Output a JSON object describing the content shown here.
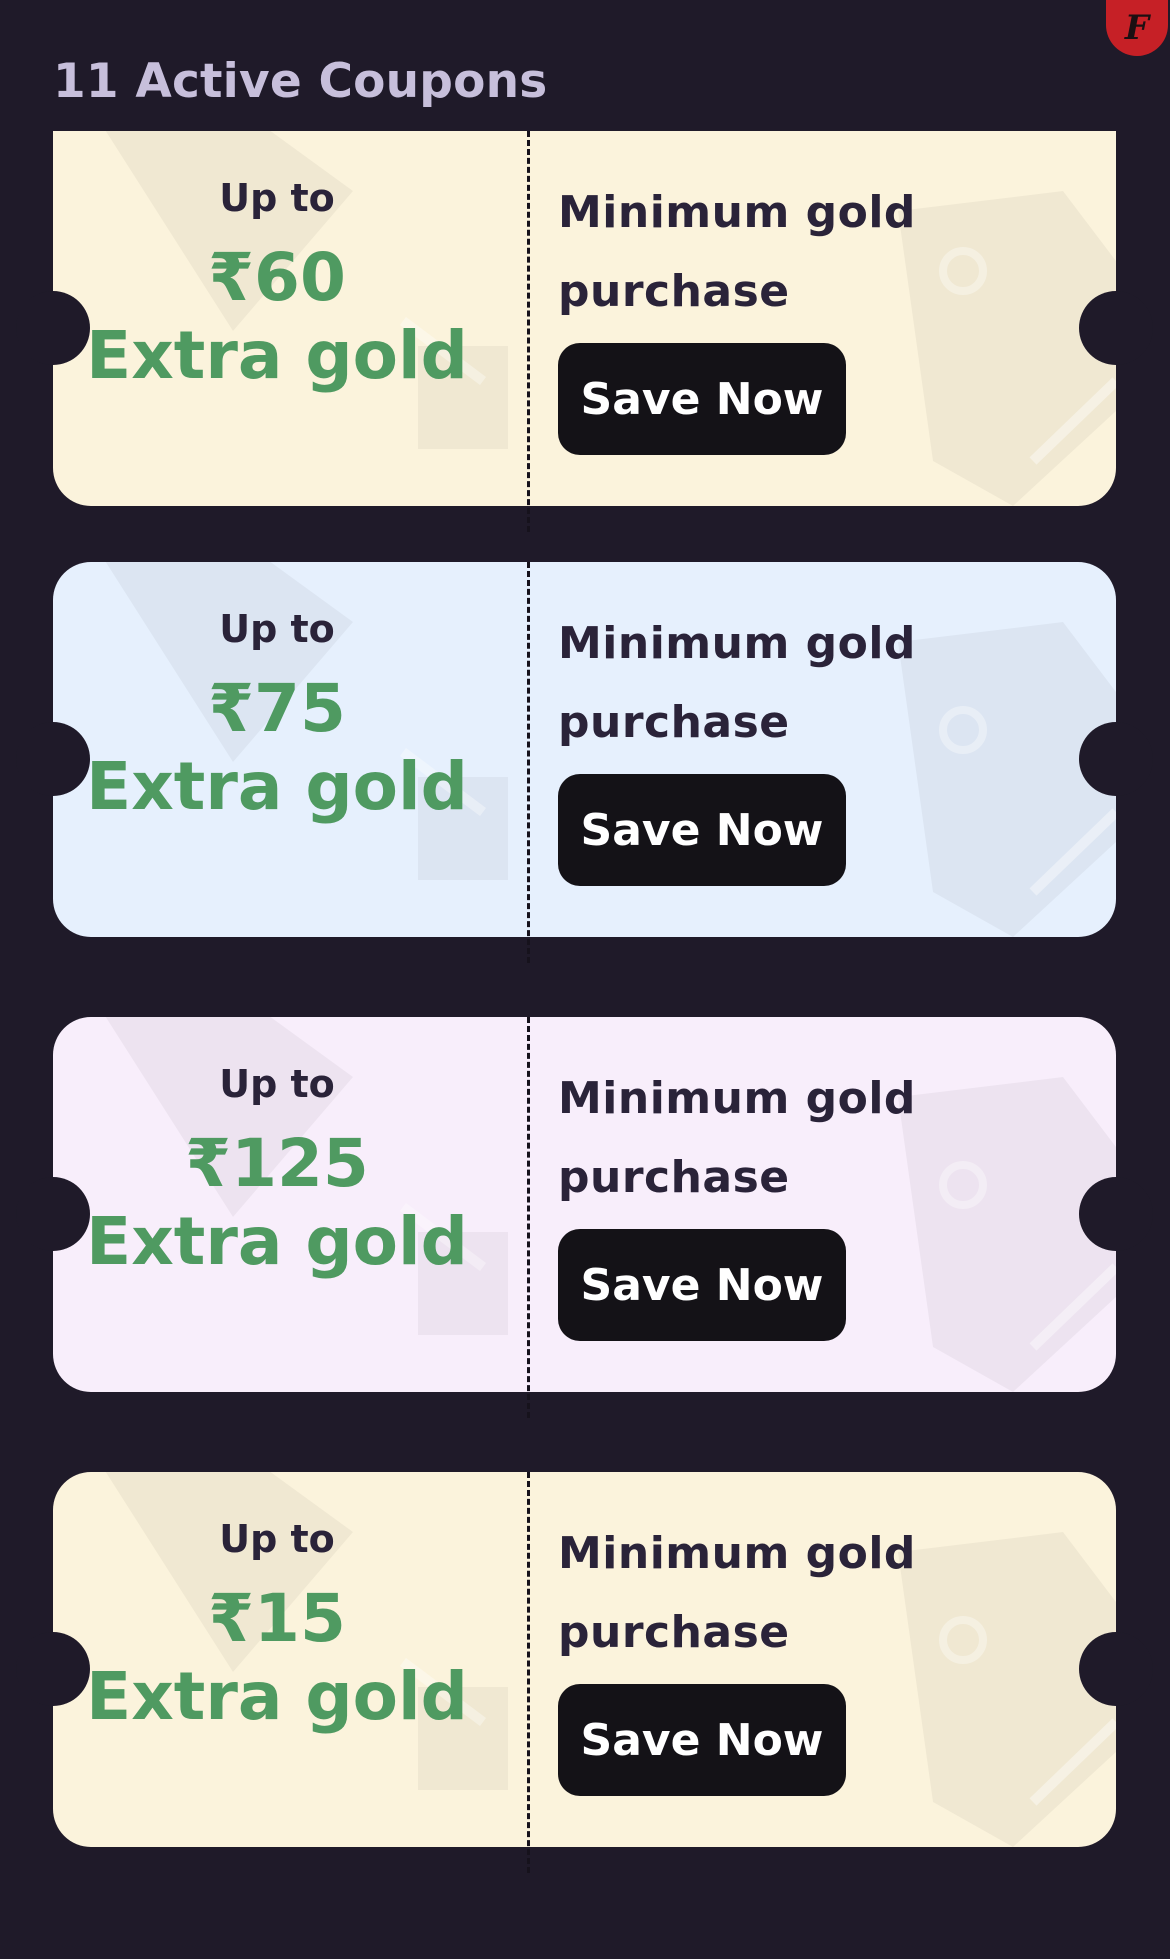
{
  "badge": {
    "letter": "F"
  },
  "header": {
    "title": "11 Active Coupons"
  },
  "coupons": [
    {
      "upto_label": "Up to",
      "amount": "₹60",
      "reward_label": "Extra gold",
      "min_label": "Minimum gold purchase",
      "button_label": "Save Now",
      "bg_color": "#fbf3dc"
    },
    {
      "upto_label": "Up to",
      "amount": "₹75",
      "reward_label": "Extra gold",
      "min_label": "Minimum gold purchase",
      "button_label": "Save Now",
      "bg_color": "#e6f0fd"
    },
    {
      "upto_label": "Up to",
      "amount": "₹125",
      "reward_label": "Extra gold",
      "min_label": "Minimum gold purchase",
      "button_label": "Save Now",
      "bg_color": "#f8eefb"
    },
    {
      "upto_label": "Up to",
      "amount": "₹15",
      "reward_label": "Extra gold",
      "min_label": "Minimum gold purchase",
      "button_label": "Save Now",
      "bg_color": "#fbf3dc"
    }
  ],
  "colors": {
    "page_bg": "#1f1a29",
    "accent_green": "#4f9a61",
    "button_bg": "#141217",
    "title_color": "#c7bfdb",
    "badge_red": "#c62026"
  }
}
